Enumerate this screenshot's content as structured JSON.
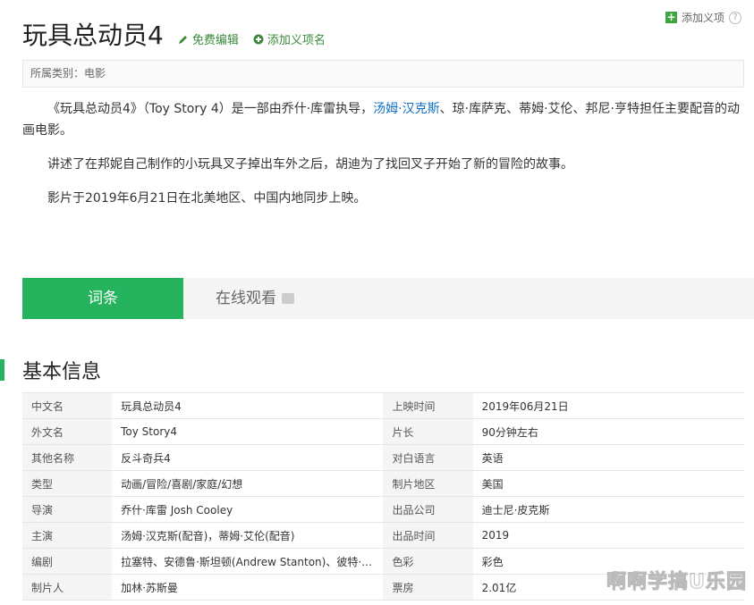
{
  "top_right": {
    "add_label": "添加义项",
    "help": "?"
  },
  "title": "玩具总动员4",
  "title_links": {
    "edit": "免费编辑",
    "add_name": "添加义项名"
  },
  "category": "所属类别：电影",
  "summary": {
    "p1_before": "《玩具总动员4》（Toy Story 4）是一部由乔什·库雷执导，",
    "p1_link": "汤姆·汉克斯",
    "p1_after": "、琼·库萨克、蒂姆·艾伦、邦尼·亨特担任主要配音的动画电影。",
    "p2": "讲述了在邦妮自己制作的小玩具叉子掉出车外之后，胡迪为了找回叉子开始了新的冒险的故事。",
    "p3": "影片于2019年6月21日在北美地区、中国内地同步上映。"
  },
  "tabs": {
    "active": "词条",
    "other": "在线观看"
  },
  "section_title": "基本信息",
  "info_rows": [
    {
      "k1": "中文名",
      "v1": "玩具总动员4",
      "k2": "上映时间",
      "v2": "2019年06月21日"
    },
    {
      "k1": "外文名",
      "v1": "Toy Story4",
      "k2": "片长",
      "v2": "90分钟左右"
    },
    {
      "k1": "其他名称",
      "v1": "反斗奇兵4",
      "k2": "对白语言",
      "v2": "英语"
    },
    {
      "k1": "类型",
      "v1": "动画/冒险/喜剧/家庭/幻想",
      "k2": "制片地区",
      "v2": "美国"
    },
    {
      "k1": "导演",
      "v1": "乔什·库雷 Josh Cooley",
      "k2": "出品公司",
      "v2": "迪士尼·皮克斯"
    },
    {
      "k1": "主演",
      "v1": "汤姆·汉克斯(配音)，蒂姆·艾伦(配音)",
      "k2": "出品时间",
      "v2": "2019"
    },
    {
      "k1": "编剧",
      "v1": "拉塞特、安德鲁·斯坦顿(Andrew Stanton)、彼特·道格...",
      "k2": "色彩",
      "v2": "彩色"
    },
    {
      "k1": "制片人",
      "v1": "加林·苏斯曼",
      "k2": "票房",
      "v2": "2.01亿"
    }
  ],
  "watermark": "啊啊学搞U乐园",
  "colors": {
    "accent": "#25b35d",
    "link": "#136ec2",
    "edit_green": "#3a8a3a"
  }
}
